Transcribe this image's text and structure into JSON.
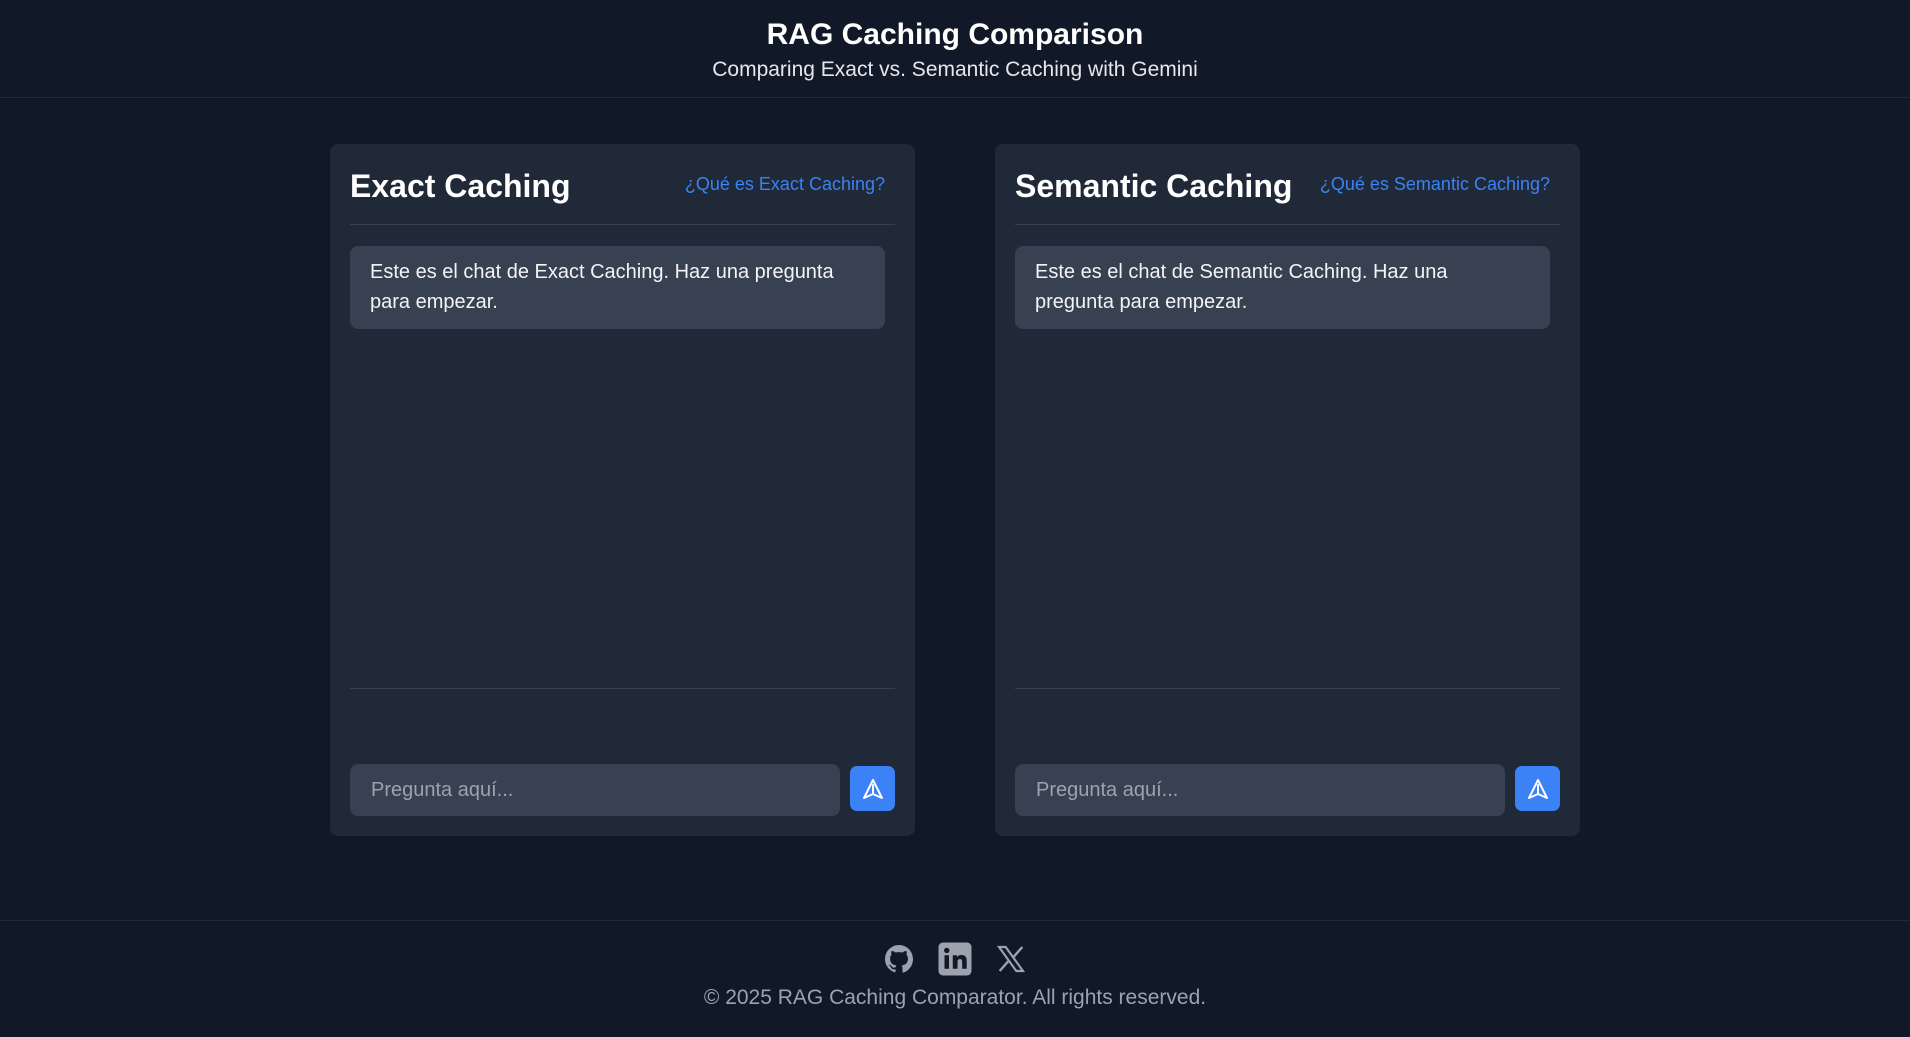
{
  "header": {
    "title": "RAG Caching Comparison",
    "subtitle": "Comparing Exact vs. Semantic Caching with Gemini"
  },
  "panels": [
    {
      "title": "Exact Caching",
      "link": "¿Qué es Exact Caching?",
      "message": "Este es el chat de Exact Caching. Haz una pregunta para empezar.",
      "input_placeholder": "Pregunta aquí...",
      "input_value": ""
    },
    {
      "title": "Semantic Caching",
      "link": "¿Qué es Semantic Caching?",
      "message": "Este es el chat de Semantic Caching. Haz una pregunta para empezar.",
      "input_placeholder": "Pregunta aquí...",
      "input_value": ""
    }
  ],
  "footer": {
    "socials": [
      "github-icon",
      "linkedin-icon",
      "x-icon"
    ],
    "copyright": "© 2025 RAG Caching Comparator. All rights reserved."
  },
  "colors": {
    "background": "#111827",
    "panel": "#1f2937",
    "bubble": "#374151",
    "accent": "#3b82f6",
    "muted_text": "#9ca3af"
  }
}
